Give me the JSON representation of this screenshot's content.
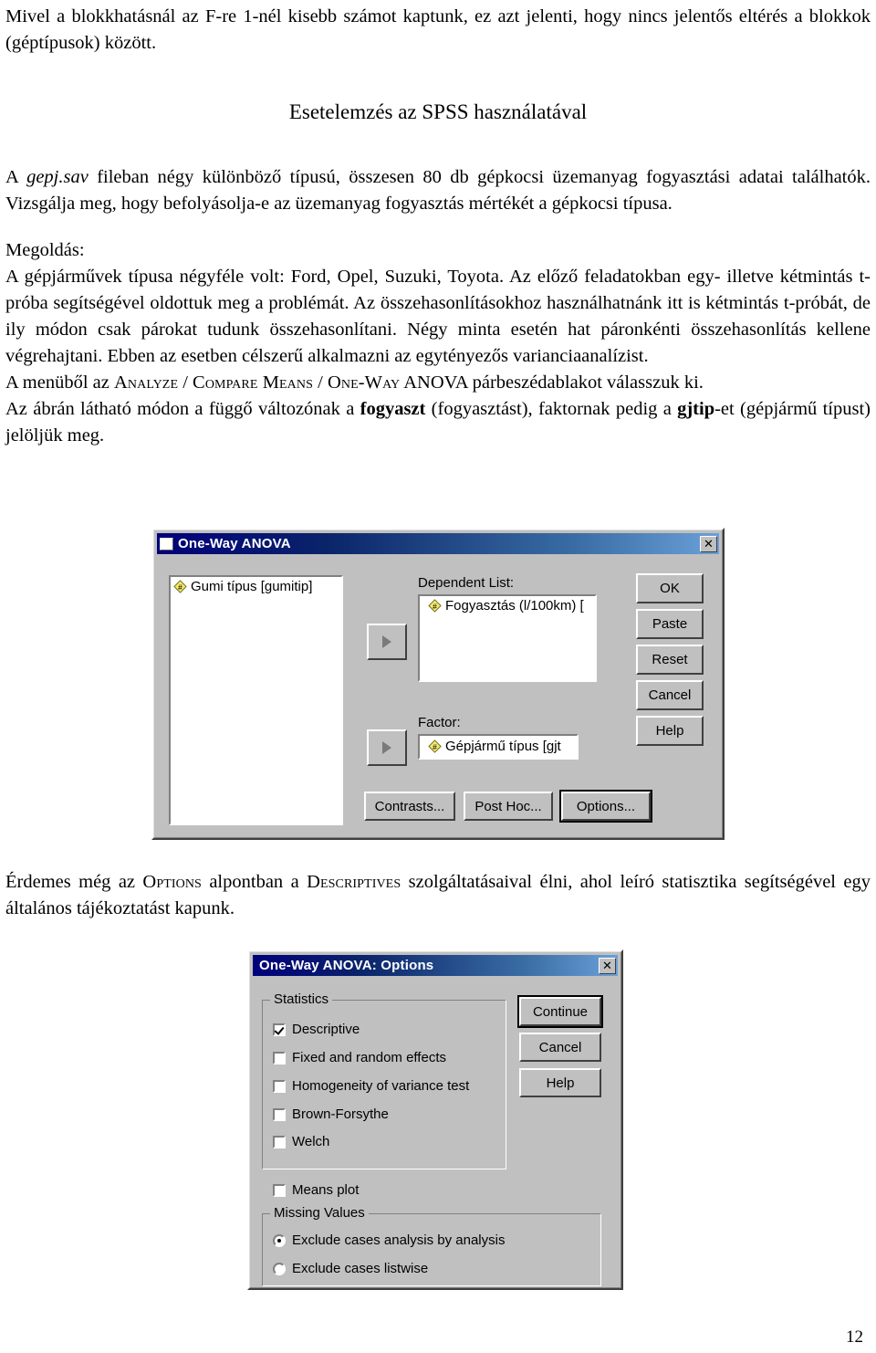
{
  "document": {
    "intro_paragraph": "Mivel a blokkhatásnál az F-re 1-nél kisebb számot kaptunk, ez azt jelenti, hogy nincs jelentős eltérés a blokkok (géptípusok) között.",
    "section_title": "Esetelemzés az SPSS használatával",
    "task_p1_a": "A ",
    "task_p1_file": "gepj.sav",
    "task_p1_b": " fileban négy különböző típusú, összesen 80 db gépkocsi üzemanyag fogyasztási adatai találhatók. Vizsgálja meg, hogy befolyásolja-e az üzemanyag fogyasztás mértékét a gépkocsi típusa.",
    "solution_label": "Megoldás:",
    "solution_paragraph": "A gépjárművek típusa négyféle volt: Ford, Opel, Suzuki, Toyota. Az előző feladatokban egy- illetve kétmintás t-próba segítségével oldottuk meg a problémát. Az összehasonlításokhoz használhatnánk itt is kétmintás t-próbát, de ily módon csak párokat tudunk összehasonlítani. Négy minta esetén hat páronkénti összehasonlítás kellene végrehajtani. Ebben az esetben célszerű alkalmazni az egytényezős varianciaanalízist.",
    "menu_line_a": "A menüből az ",
    "menu_analyze": "Analyze",
    "menu_sep1": " / ",
    "menu_compare": "Compare Means",
    "menu_sep2": " / ",
    "menu_oneway": "One-Way",
    "menu_line_b": " ANOVA párbeszédablakot válasszuk ki.",
    "figure_line_a": "Az ábrán látható módon a függő változónak a ",
    "figure_bold1": "fogyaszt",
    "figure_line_b": " (fogyasztást), faktornak pedig a ",
    "figure_bold2": "gjtip",
    "figure_line_c": "-et (gépjármű típust) jelöljük meg.",
    "options_note_a": "Érdemes még az ",
    "options_note_opt": "Options",
    "options_note_b": " alpontban a ",
    "options_note_desc": "Descriptives",
    "options_note_c": " szolgáltatásaival élni, ahol leíró statisztika segítségével egy általános tájékoztatást kapunk.",
    "page_number": "12"
  },
  "anova_dialog": {
    "title": "One-Way ANOVA",
    "close_label": "✕",
    "source_variable": "Gumi típus [gumitip]",
    "dependent_label": "Dependent List:",
    "dependent_variable": "Fogyasztás (l/100km) [",
    "factor_label": "Factor:",
    "factor_variable": "Gépjármű típus [gjt",
    "buttons_right": [
      "OK",
      "Paste",
      "Reset",
      "Cancel",
      "Help"
    ],
    "buttons_bottom": [
      "Contrasts...",
      "Post Hoc...",
      "Options..."
    ],
    "default_bottom_button": "Options..."
  },
  "options_dialog": {
    "title": "One-Way ANOVA: Options",
    "close_label": "✕",
    "statistics_group": "Statistics",
    "statistics_items": [
      {
        "label": "Descriptive",
        "checked": true
      },
      {
        "label": "Fixed and random effects",
        "checked": false
      },
      {
        "label": "Homogeneity of variance test",
        "checked": false
      },
      {
        "label": "Brown-Forsythe",
        "checked": false
      },
      {
        "label": "Welch",
        "checked": false
      }
    ],
    "means_plot": {
      "label": "Means plot",
      "checked": false
    },
    "missing_group": "Missing Values",
    "missing_items": [
      {
        "label": "Exclude cases analysis by analysis",
        "selected": true
      },
      {
        "label": "Exclude cases listwise",
        "selected": false
      }
    ],
    "buttons_right": [
      "Continue",
      "Cancel",
      "Help"
    ],
    "default_button": "Continue"
  },
  "colors": {
    "titlebar_start": "#00007b",
    "titlebar_end": "#6aa0d8",
    "dialog_face": "#c0c0c0",
    "variable_icon": "#f5e96b"
  }
}
